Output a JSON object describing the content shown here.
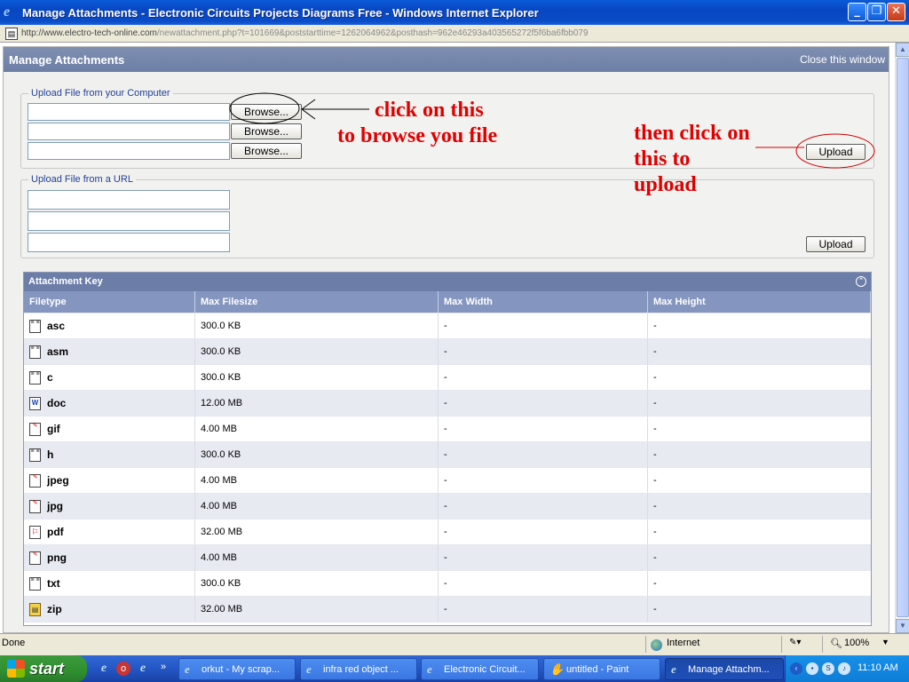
{
  "window": {
    "title": "Manage Attachments - Electronic Circuits Projects Diagrams Free - Windows Internet Explorer",
    "minimize": "_",
    "restore": "❐",
    "close": "✕"
  },
  "address": {
    "url_domain": "http://www.electro-tech-online.com",
    "url_path": "/newattachment.php?t=101669&poststarttime=1262064962&posthash=962e46293a403565272f5f6ba6fbb079"
  },
  "page": {
    "header_title": "Manage Attachments",
    "close_link": "Close this window",
    "upload_computer_legend": "Upload File from your Computer",
    "browse_label": "Browse...",
    "upload_url_legend": "Upload File from a URL",
    "upload_label": "Upload"
  },
  "annotations": {
    "browse_line1": "click on this",
    "browse_line2": "to browse you file",
    "upload_line1": "then click on",
    "upload_line2": "this to",
    "upload_line3": "upload"
  },
  "attachment_key": {
    "title": "Attachment Key",
    "collapse_icon": "collapse-icon",
    "headers": [
      "Filetype",
      "Max Filesize",
      "Max Width",
      "Max Height"
    ],
    "rows": [
      {
        "type": "asc",
        "size": "300.0 KB",
        "width": "-",
        "height": "-",
        "icon": "text-file-icon"
      },
      {
        "type": "asm",
        "size": "300.0 KB",
        "width": "-",
        "height": "-",
        "icon": "text-file-icon"
      },
      {
        "type": "c",
        "size": "300.0 KB",
        "width": "-",
        "height": "-",
        "icon": "text-file-icon"
      },
      {
        "type": "doc",
        "size": "12.00 MB",
        "width": "-",
        "height": "-",
        "icon": "word-file-icon"
      },
      {
        "type": "gif",
        "size": "4.00 MB",
        "width": "-",
        "height": "-",
        "icon": "image-file-icon"
      },
      {
        "type": "h",
        "size": "300.0 KB",
        "width": "-",
        "height": "-",
        "icon": "text-file-icon"
      },
      {
        "type": "jpeg",
        "size": "4.00 MB",
        "width": "-",
        "height": "-",
        "icon": "image-file-icon"
      },
      {
        "type": "jpg",
        "size": "4.00 MB",
        "width": "-",
        "height": "-",
        "icon": "image-file-icon"
      },
      {
        "type": "pdf",
        "size": "32.00 MB",
        "width": "-",
        "height": "-",
        "icon": "pdf-file-icon"
      },
      {
        "type": "png",
        "size": "4.00 MB",
        "width": "-",
        "height": "-",
        "icon": "image-file-icon"
      },
      {
        "type": "txt",
        "size": "300.0 KB",
        "width": "-",
        "height": "-",
        "icon": "text-file-icon"
      },
      {
        "type": "zip",
        "size": "32.00 MB",
        "width": "-",
        "height": "-",
        "icon": "zip-file-icon"
      }
    ]
  },
  "status": {
    "text": "Done",
    "zone": "Internet",
    "zoom": "100%"
  },
  "taskbar": {
    "start": "start",
    "more": "»",
    "tasks": [
      {
        "label": "orkut - My scrap...",
        "active": false
      },
      {
        "label": "infra red object ...",
        "active": false
      },
      {
        "label": "Electronic Circuit...",
        "active": false
      },
      {
        "label": "untitled - Paint",
        "active": false
      },
      {
        "label": "Manage Attachm...",
        "active": true
      }
    ],
    "clock": "11:10 AM"
  },
  "colors": {
    "titlebar": "#0a5bd8",
    "panel_header": "#7f8fb2",
    "annotation": "#e00000",
    "table_header": "#8495bf",
    "taskbar": "#2457c5",
    "start_button": "#2f8f2f"
  }
}
